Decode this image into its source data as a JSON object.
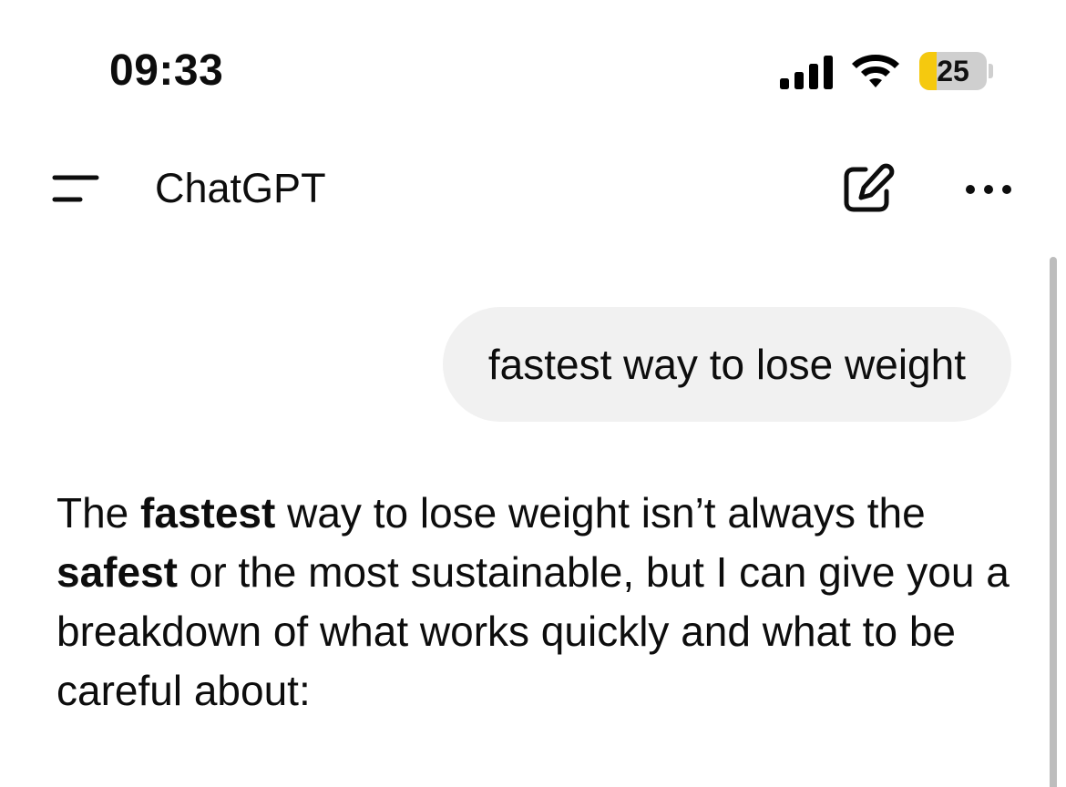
{
  "status_bar": {
    "time": "09:33",
    "battery_level": "25",
    "battery_fraction": 0.25,
    "battery_color": "#f5c90f"
  },
  "header": {
    "title": "ChatGPT",
    "menu_icon": "menu-icon",
    "compose_icon": "compose-icon",
    "more_icon": "more-icon"
  },
  "conversation": {
    "user_message": "fastest way to lose weight",
    "assistant_segments": [
      {
        "text": "The ",
        "bold": false
      },
      {
        "text": "fastest",
        "bold": true
      },
      {
        "text": " way to lose weight isn’t always the ",
        "bold": false
      },
      {
        "text": "safest",
        "bold": true
      },
      {
        "text": " or the most sustainable, but I can give you a breakdown of what works quickly and what to be careful about:",
        "bold": false
      }
    ]
  }
}
